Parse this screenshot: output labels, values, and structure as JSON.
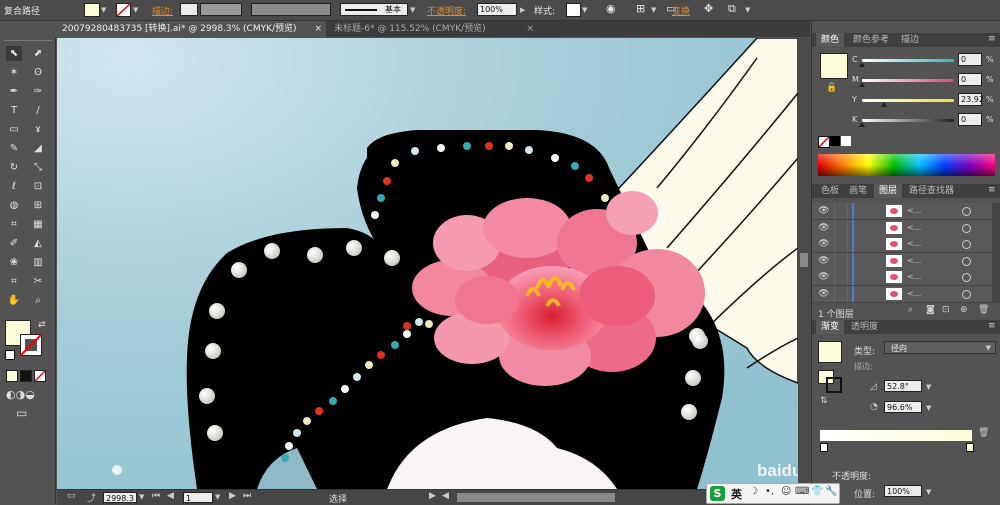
{
  "control_bar": {
    "mode_label": "复合路径",
    "stroke_label": "描边:",
    "brush_label": "基本",
    "opacity_label": "不透明度:",
    "opacity_value": "100%",
    "style_label": "样式:",
    "transform_label": "变换",
    "fill_color": "#fdfdd8"
  },
  "tabs": [
    {
      "label": "20079280483735 [转换].ai* @ 2998.3% (CMYK/预览)",
      "close": "×"
    },
    {
      "label": "未标题-6* @ 115.52% (CMYK/预览)",
      "close": "×"
    }
  ],
  "tool_icons": [
    "selection-icon",
    "direct-selection-icon",
    "magic-wand-icon",
    "lasso-icon",
    "pen-icon",
    "curvature-icon",
    "type-icon",
    "line-icon",
    "rectangle-icon",
    "paintbrush-icon",
    "pencil-icon",
    "eraser-icon",
    "rotate-icon",
    "scale-icon",
    "warp-icon",
    "free-transform-icon",
    "shape-builder-icon",
    "perspective-icon",
    "mesh-icon",
    "gradient-icon",
    "eyedropper-icon",
    "blend-icon",
    "symbol-sprayer-icon",
    "graph-icon",
    "artboard-icon",
    "slice-icon",
    "hand-icon",
    "zoom-icon"
  ],
  "panels": {
    "color": {
      "tabs": [
        "颜色",
        "颜色参考",
        "描边"
      ],
      "channels": [
        {
          "name": "C",
          "value": "0",
          "fraction": 0.0,
          "track": "#2fb8c0"
        },
        {
          "name": "M",
          "value": "0",
          "fraction": 0.0,
          "track": "#e0407a"
        },
        {
          "name": "Y",
          "value": "23.92",
          "fraction": 0.24,
          "track": "#e8e030"
        },
        {
          "name": "K",
          "value": "0",
          "fraction": 0.0,
          "track": "#222222"
        }
      ],
      "fill_color": "#fdfdd8"
    },
    "layers": {
      "tabs": [
        "色板",
        "画笔",
        "图层",
        "路径查找器"
      ],
      "rows": 6,
      "footer": "1 个图层"
    },
    "gradient": {
      "tabs": [
        "渐变",
        "透明度"
      ],
      "type_label": "类型:",
      "type_value": "径向",
      "stroke_label": "描边:",
      "angle_value": "52.8°",
      "ratio_value": "96.6%",
      "opacity_label": "不透明度:",
      "position_label": "位置:",
      "position_value": "100%"
    }
  },
  "status_bar": {
    "zoom": "2998.3",
    "page": "1",
    "tool": "选择"
  },
  "ime": {
    "logo": "S",
    "lang": "英"
  },
  "watermark": "Baidu 经验 jingyan.baidu.com",
  "colors": {
    "sky_top": "#9cc9d6",
    "sky_bottom": "#c8e4ec",
    "hair": "#000000",
    "peony": "#f07090",
    "fan": "#fcfaea"
  }
}
